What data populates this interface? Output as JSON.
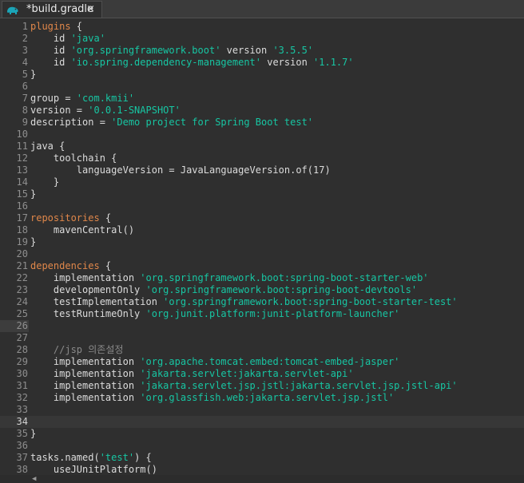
{
  "tab": {
    "title": "*build.gradle",
    "icon": "gradle-elephant-icon",
    "close_glyph": "×",
    "dirty": true
  },
  "editor": {
    "current_line": 34,
    "colors": {
      "background": "#2f2f2f",
      "keyword": "#e0874a",
      "string": "#17c6a3",
      "comment": "#8a8a8a",
      "text": "#dcdcdc"
    },
    "lines": [
      {
        "n": "1",
        "tokens": [
          [
            "kw",
            "plugins"
          ],
          [
            "t",
            " {"
          ]
        ]
      },
      {
        "n": "2",
        "tokens": [
          [
            "t",
            "    id "
          ],
          [
            "str",
            "'java'"
          ]
        ]
      },
      {
        "n": "3",
        "tokens": [
          [
            "t",
            "    id "
          ],
          [
            "str",
            "'org.springframework.boot'"
          ],
          [
            "t",
            " version "
          ],
          [
            "str",
            "'3.5.5'"
          ]
        ]
      },
      {
        "n": "4",
        "tokens": [
          [
            "t",
            "    id "
          ],
          [
            "str",
            "'io.spring.dependency-management'"
          ],
          [
            "t",
            " version "
          ],
          [
            "str",
            "'1.1.7'"
          ]
        ]
      },
      {
        "n": "5",
        "tokens": [
          [
            "t",
            "}"
          ]
        ]
      },
      {
        "n": "6",
        "tokens": []
      },
      {
        "n": "7",
        "tokens": [
          [
            "t",
            "group = "
          ],
          [
            "str",
            "'com.kmii'"
          ]
        ]
      },
      {
        "n": "8",
        "tokens": [
          [
            "t",
            "version = "
          ],
          [
            "str",
            "'0.0.1-SNAPSHOT'"
          ]
        ]
      },
      {
        "n": "9",
        "tokens": [
          [
            "t",
            "description = "
          ],
          [
            "str",
            "'Demo project for Spring Boot test'"
          ]
        ]
      },
      {
        "n": "10",
        "tokens": []
      },
      {
        "n": "11",
        "tokens": [
          [
            "t",
            "java {"
          ]
        ]
      },
      {
        "n": "12",
        "tokens": [
          [
            "t",
            "    toolchain {"
          ]
        ]
      },
      {
        "n": "13",
        "tokens": [
          [
            "t",
            "        languageVersion = JavaLanguageVersion.of(17)"
          ]
        ]
      },
      {
        "n": "14",
        "tokens": [
          [
            "t",
            "    }"
          ]
        ]
      },
      {
        "n": "15",
        "tokens": [
          [
            "t",
            "}"
          ]
        ]
      },
      {
        "n": "16",
        "tokens": []
      },
      {
        "n": "17",
        "tokens": [
          [
            "kw",
            "repositories"
          ],
          [
            "t",
            " {"
          ]
        ]
      },
      {
        "n": "18",
        "tokens": [
          [
            "t",
            "    mavenCentral()"
          ]
        ]
      },
      {
        "n": "19",
        "tokens": [
          [
            "t",
            "}"
          ]
        ]
      },
      {
        "n": "20",
        "tokens": []
      },
      {
        "n": "21",
        "tokens": [
          [
            "kw",
            "dependencies"
          ],
          [
            "t",
            " {"
          ]
        ]
      },
      {
        "n": "22",
        "tokens": [
          [
            "t",
            "    implementation "
          ],
          [
            "str",
            "'org.springframework.boot:spring-boot-starter-web'"
          ]
        ]
      },
      {
        "n": "23",
        "tokens": [
          [
            "t",
            "    developmentOnly "
          ],
          [
            "str",
            "'org.springframework.boot:spring-boot-devtools'"
          ]
        ]
      },
      {
        "n": "24",
        "tokens": [
          [
            "t",
            "    testImplementation "
          ],
          [
            "str",
            "'org.springframework.boot:spring-boot-starter-test'"
          ]
        ]
      },
      {
        "n": "25",
        "tokens": [
          [
            "t",
            "    testRuntimeOnly "
          ],
          [
            "str",
            "'org.junit.platform:junit-platform-launcher'"
          ]
        ]
      },
      {
        "n": "26",
        "tokens": [],
        "occ": true
      },
      {
        "n": "27",
        "tokens": []
      },
      {
        "n": "28",
        "tokens": [
          [
            "cm",
            "    //jsp 의존설정"
          ]
        ]
      },
      {
        "n": "29",
        "tokens": [
          [
            "t",
            "    implementation "
          ],
          [
            "str",
            "'org.apache.tomcat.embed:tomcat-embed-jasper'"
          ]
        ]
      },
      {
        "n": "30",
        "tokens": [
          [
            "t",
            "    implementation "
          ],
          [
            "str",
            "'jakarta.servlet:jakarta.servlet-api'"
          ]
        ]
      },
      {
        "n": "31",
        "tokens": [
          [
            "t",
            "    implementation "
          ],
          [
            "str",
            "'jakarta.servlet.jsp.jstl:jakarta.servlet.jsp.jstl-api'"
          ]
        ]
      },
      {
        "n": "32",
        "tokens": [
          [
            "t",
            "    implementation "
          ],
          [
            "str",
            "'org.glassfish.web:jakarta.servlet.jsp.jstl'"
          ]
        ]
      },
      {
        "n": "33",
        "tokens": []
      },
      {
        "n": "34",
        "tokens": []
      },
      {
        "n": "35",
        "tokens": [
          [
            "t",
            "}"
          ]
        ]
      },
      {
        "n": "36",
        "tokens": []
      },
      {
        "n": "37",
        "tokens": [
          [
            "t",
            "tasks.named("
          ],
          [
            "str",
            "'test'"
          ],
          [
            "t",
            ") {"
          ]
        ]
      },
      {
        "n": "38",
        "tokens": [
          [
            "t",
            "    useJUnitPlatform()"
          ]
        ]
      }
    ]
  },
  "scrollbar": {
    "left_arrow": "◀"
  }
}
